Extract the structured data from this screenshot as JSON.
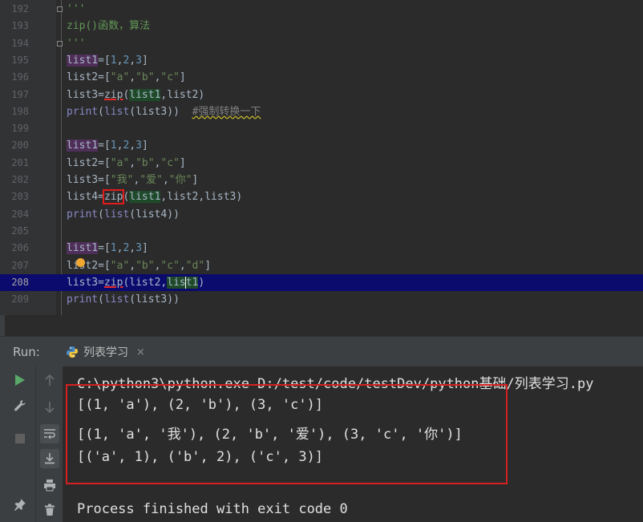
{
  "editor": {
    "lines": [
      {
        "n": "192"
      },
      {
        "n": "193"
      },
      {
        "n": "194"
      },
      {
        "n": "195"
      },
      {
        "n": "196"
      },
      {
        "n": "197"
      },
      {
        "n": "198"
      },
      {
        "n": "199"
      },
      {
        "n": "200"
      },
      {
        "n": "201"
      },
      {
        "n": "202"
      },
      {
        "n": "203"
      },
      {
        "n": "204"
      },
      {
        "n": "205"
      },
      {
        "n": "206"
      },
      {
        "n": "207"
      },
      {
        "n": "208"
      },
      {
        "n": "209"
      }
    ],
    "current_line": "208",
    "docstring_title": "zip()函数，算法",
    "comment_cast": "#强制转换一下"
  },
  "run": {
    "label": "Run:",
    "tab_name": "列表学习",
    "close": "×",
    "output": {
      "command": "C:\\python3\\python.exe D:/test/code/testDev/python基础/列表学习.py",
      "line1": "[(1, 'a'), (2, 'b'), (3, 'c')]",
      "line2": "[(1, 'a', '我'), (2, 'b', '爱'), (3, 'c', '你')]",
      "line3": "[('a', 1), ('b', 2), ('c', 3)]",
      "finished": "Process finished with exit code 0"
    }
  },
  "icons": {
    "run": "play-icon",
    "up": "arrow-up-icon",
    "wrench": "wrench-icon",
    "down": "arrow-down-icon",
    "stop": "stop-icon",
    "soft_wrap": "soft-wrap-icon",
    "scroll_end": "scroll-to-end-icon",
    "print": "print-icon",
    "pin": "pin-icon",
    "trash": "trash-icon",
    "python": "python-icon",
    "bulb": "lightbulb-icon"
  },
  "colors": {
    "editor_bg": "#2b2b2b",
    "current_line_bg": "#0b0b6e",
    "highlight_box": "#d62020",
    "play_green": "#59a869"
  }
}
